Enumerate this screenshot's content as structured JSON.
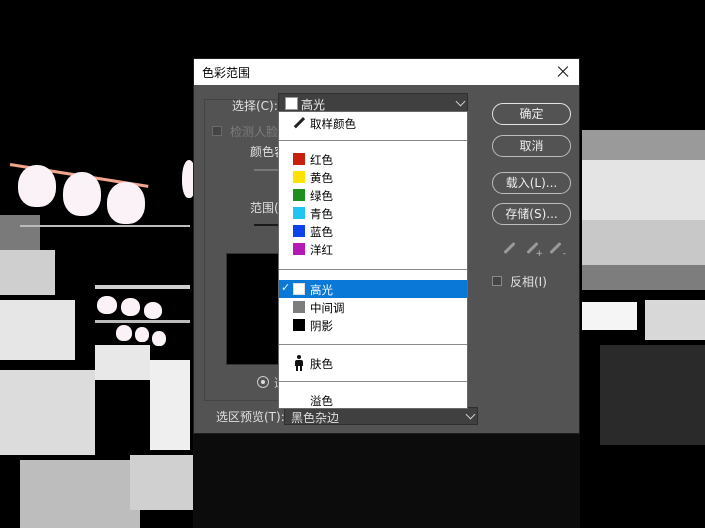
{
  "dialog": {
    "title": "色彩范围",
    "select_label": "选择(C):",
    "select_value": "高光",
    "detect_faces_label": "检测人脸",
    "fuzziness_label": "颜色容",
    "range_label": "范围(",
    "radio_label": "选",
    "buttons": {
      "ok": "确定",
      "cancel": "取消",
      "load": "载入(L)...",
      "save": "存储(S)..."
    },
    "invert_label": "反相(I)",
    "eyedropper_plus": "+",
    "eyedropper_minus": "-",
    "preview_label": "选区预览(T):",
    "preview_value": "黑色杂边"
  },
  "dropdown": {
    "sampled": "取样颜色",
    "colors": [
      {
        "label": "红色",
        "color": "#c8200e"
      },
      {
        "label": "黄色",
        "color": "#ffe200"
      },
      {
        "label": "绿色",
        "color": "#1f8f1f"
      },
      {
        "label": "青色",
        "color": "#22c4f2"
      },
      {
        "label": "蓝色",
        "color": "#0b43e8"
      },
      {
        "label": "洋红",
        "color": "#b41ab4"
      }
    ],
    "tones": [
      {
        "label": "高光",
        "color": "#ffffff",
        "selected": true,
        "check": "✓"
      },
      {
        "label": "中间调",
        "color": "#7d7d7d",
        "selected": false
      },
      {
        "label": "阴影",
        "color": "#000000",
        "selected": false
      }
    ],
    "skin": "肤色",
    "overflow": "溢色"
  }
}
